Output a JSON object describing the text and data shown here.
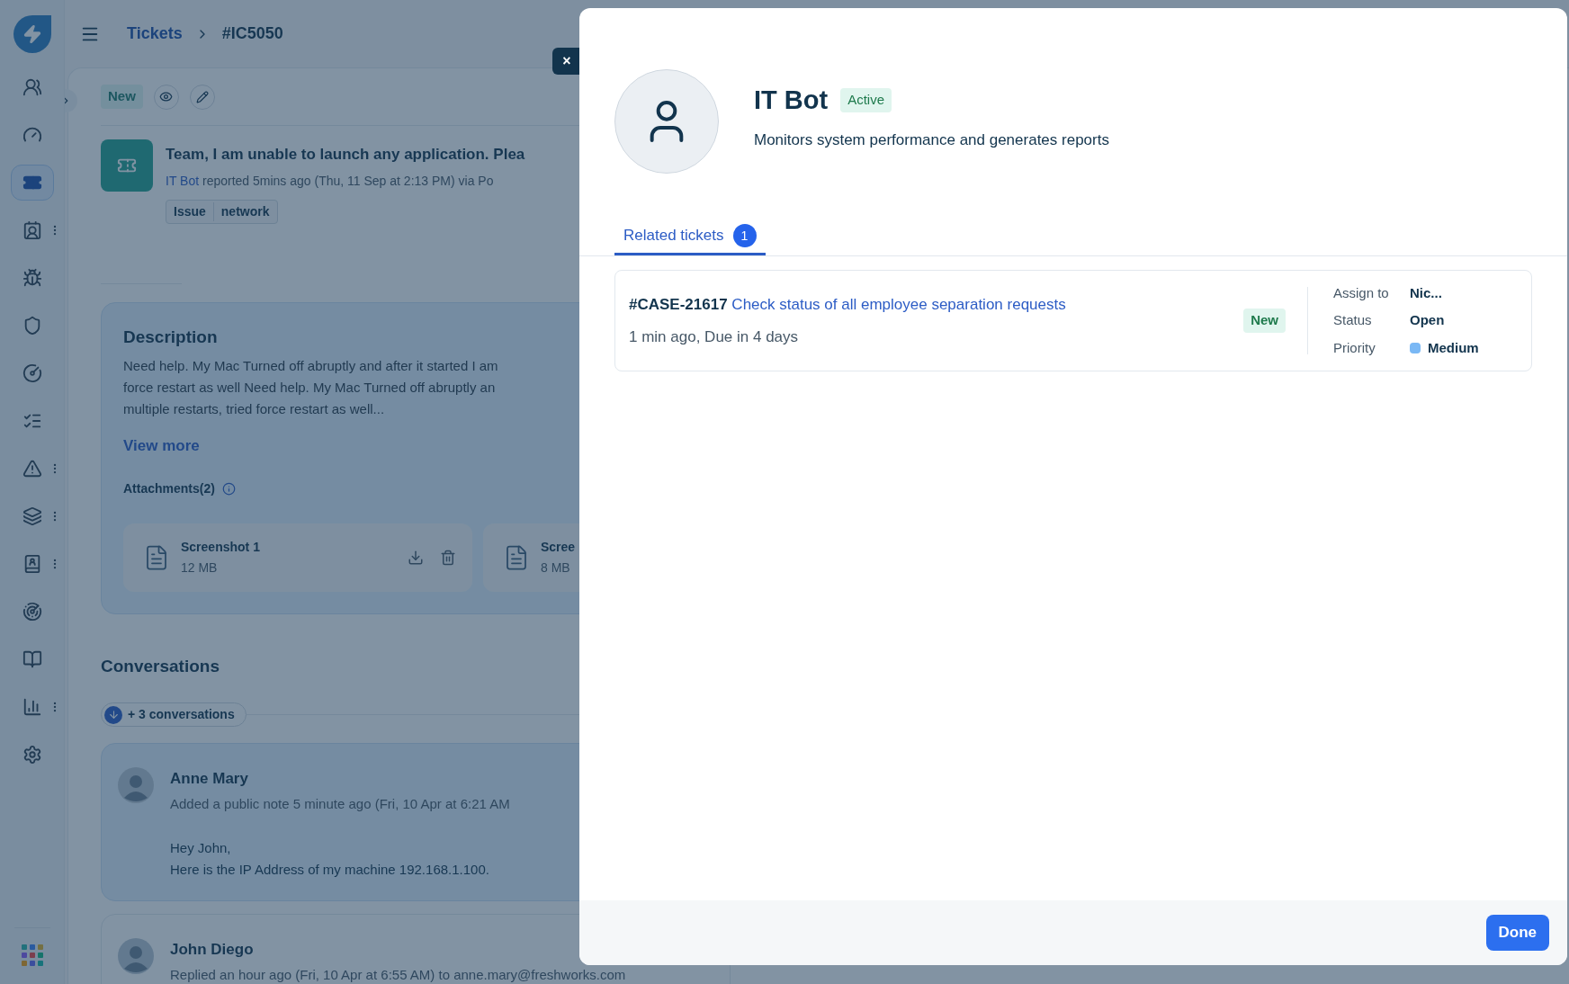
{
  "header": {
    "breadcrumb": [
      {
        "label": "Tickets",
        "kind": "link"
      },
      {
        "label": "#IC5050",
        "kind": "current"
      }
    ]
  },
  "sidebar": {
    "items": [
      {
        "selected": false,
        "has_menu": false
      },
      {
        "selected": false,
        "has_menu": false
      },
      {
        "selected": true,
        "has_menu": false
      },
      {
        "selected": false,
        "has_menu": true
      },
      {
        "selected": false,
        "has_menu": false
      },
      {
        "selected": false,
        "has_menu": false
      },
      {
        "selected": false,
        "has_menu": false
      },
      {
        "selected": false,
        "has_menu": false
      },
      {
        "selected": false,
        "has_menu": true
      },
      {
        "selected": false,
        "has_menu": true
      },
      {
        "selected": false,
        "has_menu": true
      },
      {
        "selected": false,
        "has_menu": false
      },
      {
        "selected": false,
        "has_menu": false
      },
      {
        "selected": false,
        "has_menu": true
      },
      {
        "selected": false,
        "has_menu": false
      }
    ]
  },
  "ticket": {
    "status": "New",
    "title": "Team, I am unable to launch any application. Plea",
    "reporter": "IT Bot",
    "reported": "reported 5mins ago (Thu, 11 Sep at 2:13 PM) via Po",
    "tags": [
      "Issue",
      "network"
    ]
  },
  "description": {
    "title": "Description",
    "lines": [
      "Need help. My Mac Turned off abruptly and after it started I am",
      "force restart as well Need help. My Mac Turned off abruptly an",
      "multiple restarts, tried force restart as well..."
    ],
    "view_more": "View more",
    "attachments_label": "Attachments(2)",
    "attachments": [
      {
        "name": "Screenshot 1",
        "size": "12 MB",
        "actions": true
      },
      {
        "name": "Scree",
        "size": "8 MB"
      }
    ]
  },
  "conversations": {
    "title": "Conversations",
    "more": "+ 3 conversations",
    "items": [
      {
        "author": "Anne Mary",
        "meta": "Added a public note 5 minute ago (Fri, 10 Apr at 6:21 AM",
        "body": [
          "Hey John,",
          "Here is the IP Address of my machine 192.168.1.100."
        ],
        "highlighted": true
      },
      {
        "author": "John Diego",
        "meta": "Replied an hour ago (Fri, 10 Apr at 6:55 AM) to anne.mary@freshworks.com",
        "highlighted": false
      }
    ]
  },
  "modal": {
    "close": "×",
    "name": "IT Bot",
    "status": "Active",
    "about": "Monitors system performance and generates reports",
    "tabs": [
      {
        "label": "Related tickets",
        "count": "1",
        "selected": true
      }
    ],
    "tickets": [
      {
        "id": "#CASE-21617",
        "title": "Check status of all employee separation requests",
        "meta": "1 min ago, Due in 4 days",
        "status": "New",
        "fields": [
          {
            "label": "Assign to",
            "value": "Nic..."
          },
          {
            "label": "Status",
            "value": "Open"
          },
          {
            "label": "Priority",
            "value": "Medium",
            "color": "#7ab8f5"
          }
        ]
      }
    ],
    "done": "Done"
  }
}
